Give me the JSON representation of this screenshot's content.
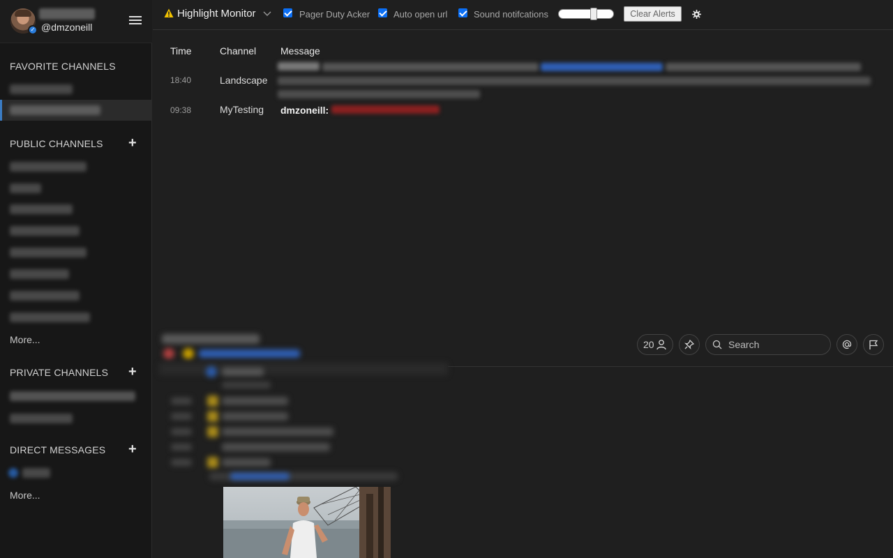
{
  "user": {
    "username": "@dmzoneill"
  },
  "sidebar": {
    "sections": {
      "favorite": {
        "title": "FAVORITE CHANNELS"
      },
      "public": {
        "title": "PUBLIC CHANNELS",
        "add": "+",
        "more": "More..."
      },
      "private": {
        "title": "PRIVATE CHANNELS",
        "add": "+"
      },
      "direct": {
        "title": "DIRECT MESSAGES",
        "add": "+",
        "more": "More..."
      }
    }
  },
  "topbar": {
    "title": "Highlight Monitor",
    "checkboxes": [
      {
        "label": "Pager Duty Acker",
        "checked": true
      },
      {
        "label": "Auto open url",
        "checked": true
      },
      {
        "label": "Sound notifcations",
        "checked": true
      }
    ],
    "volume": 0.6,
    "clear_label": "Clear Alerts"
  },
  "highlights": {
    "columns": [
      "Time",
      "Channel",
      "Message"
    ],
    "rows": [
      {
        "time": "18:40",
        "channel": "Landscape",
        "message_user": ""
      },
      {
        "time": "09:38",
        "channel": "MyTesting",
        "message_user": "dmzoneill:"
      }
    ]
  },
  "channel_header": {
    "member_count": "20",
    "search_placeholder": "Search"
  },
  "colors": {
    "accent": "#3b7cc4",
    "checkbox": "#0b6ff5",
    "sidebar_bg": "#171717",
    "main_bg": "#1f1f1f"
  }
}
